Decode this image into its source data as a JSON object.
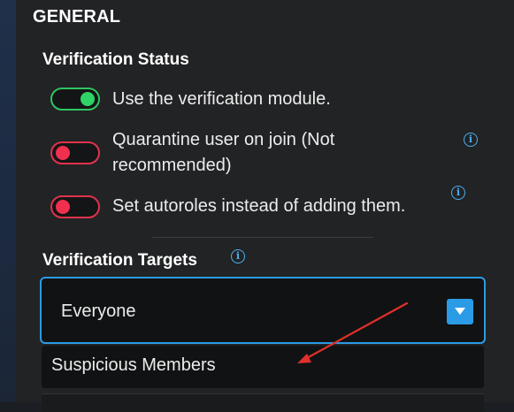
{
  "general": {
    "heading": "GENERAL"
  },
  "verification_status": {
    "heading": "Verification Status",
    "options": [
      {
        "label": "Use the verification module.",
        "enabled": true
      },
      {
        "label_line1": "Quarantine user on join (Not",
        "label_line2": "recommended)",
        "enabled": false,
        "info_icon": "info-icon"
      },
      {
        "label": "Set autoroles instead of adding them.",
        "enabled": false,
        "info_icon": "info-icon"
      }
    ]
  },
  "verification_targets": {
    "heading": "Verification Targets",
    "info_icon": "info-icon",
    "selected_value": "Everyone",
    "dropdown_options": [
      "Suspicious Members"
    ]
  },
  "colors": {
    "toggle_on": "#2fd267",
    "toggle_off": "#f0304e",
    "accent": "#2b9be6",
    "annotation_arrow": "#e0302a"
  }
}
